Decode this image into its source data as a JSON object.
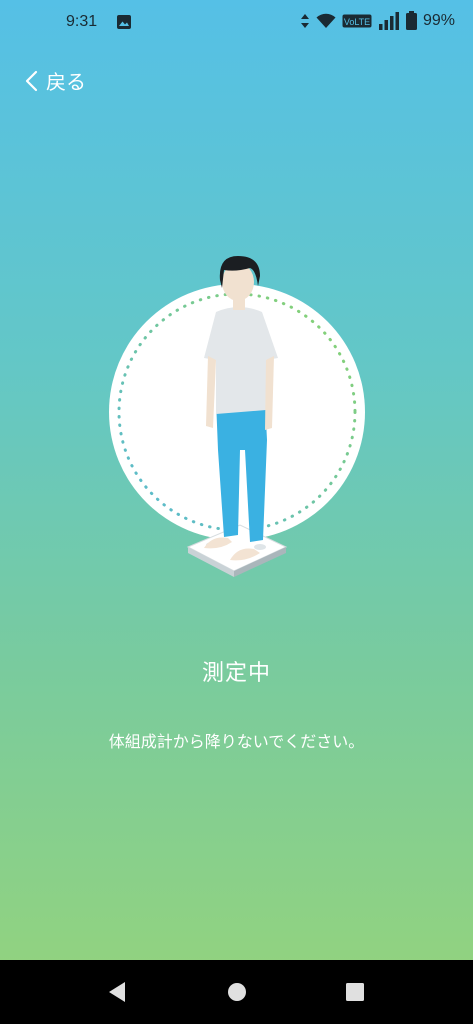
{
  "status_bar": {
    "time": "9:31",
    "volte": "VoLTE",
    "battery": "99%",
    "icons": [
      "gallery-icon",
      "data-arrows-icon",
      "wifi-icon",
      "volte-icon",
      "signal-icon",
      "battery-icon"
    ]
  },
  "header": {
    "back_label": "戻る"
  },
  "main": {
    "title": "測定中",
    "message": "体組成計から降りないでください。"
  },
  "colors": {
    "gradient_top": "#55c0e6",
    "gradient_bottom": "#96d47a",
    "text": "#ffffff",
    "nav_bar": "#000000"
  },
  "nav_bar": {
    "icons": [
      "back-triangle-icon",
      "home-circle-icon",
      "recents-square-icon"
    ]
  }
}
